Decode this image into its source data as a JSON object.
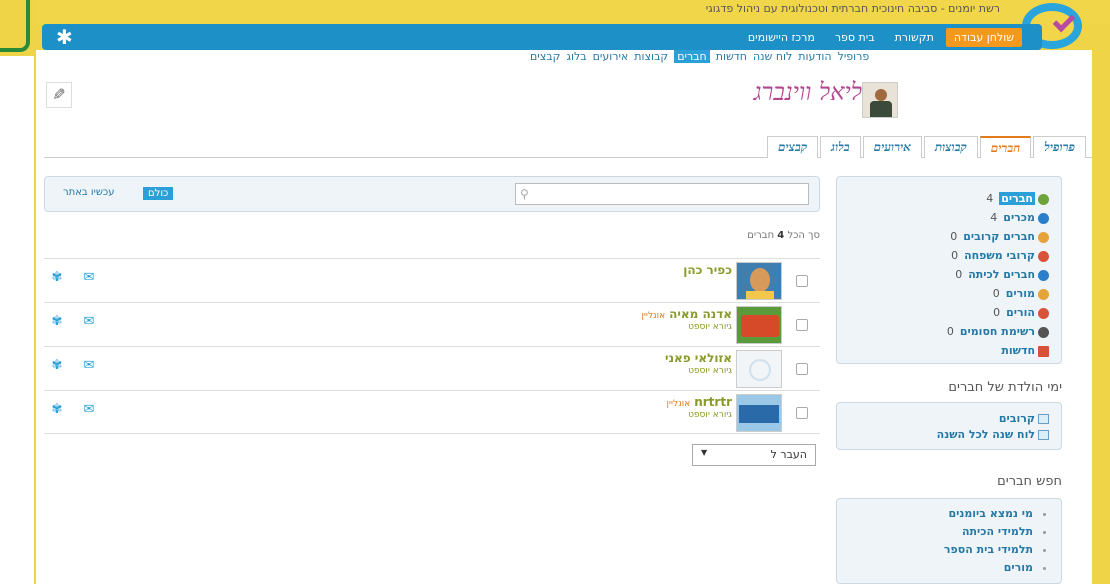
{
  "site": {
    "name": "רשת יומנים - סביבה חינוכית חברתית וטכנולוגית עם ניהול פדגוגי"
  },
  "nav": {
    "items": [
      {
        "label": "שולחן עבודה",
        "active": true
      },
      {
        "label": "תקשורת",
        "active": false
      },
      {
        "label": "בית ספר",
        "active": false
      },
      {
        "label": "מרכז היישומים",
        "active": false
      }
    ],
    "gear_icon": "gear-icon"
  },
  "subnav": {
    "items": [
      "פרופיל",
      "הודעות",
      "לוח שנה",
      "חדשות",
      "חברים",
      "קבוצות",
      "אירועים",
      "בלוג",
      "קבצים"
    ],
    "active_index": 4
  },
  "profile": {
    "name": "ליאל ווינברג"
  },
  "tabs": {
    "items": [
      "פרופיל",
      "חברים",
      "קבוצות",
      "אירועים",
      "בלוג",
      "קבצים"
    ],
    "active_index": 1
  },
  "side": {
    "items": [
      {
        "label": "חברים",
        "count": "4",
        "color": "#6ea33a",
        "active": true
      },
      {
        "label": "מכרים",
        "count": "4",
        "color": "#2a7fc8",
        "active": false
      },
      {
        "label": "חברים קרובים",
        "count": "0",
        "color": "#e6a33a",
        "active": false
      },
      {
        "label": "קרובי משפחה",
        "count": "0",
        "color": "#d8523a",
        "active": false
      },
      {
        "label": "חברים לכיתה",
        "count": "0",
        "color": "#2a7fc8",
        "active": false
      },
      {
        "label": "מורים",
        "count": "0",
        "color": "#e6a33a",
        "active": false
      },
      {
        "label": "הורים",
        "count": "0",
        "color": "#d8523a",
        "active": false
      },
      {
        "label": "רשימת חסומים",
        "count": "0",
        "color": "#555555",
        "active": false
      },
      {
        "label": "חדשות",
        "count": "",
        "color": "#d8523a",
        "active": false
      }
    ],
    "birthdays_title": "ימי הולדת של חברים",
    "birthdays": [
      "קרובים",
      "לוח שנה לכל השנה"
    ],
    "search_title": "חפש חברים",
    "search_items": [
      "מי נמצא ביומנים",
      "תלמידי הכיתה",
      "תלמידי בית הספר",
      "מורים"
    ]
  },
  "filter": {
    "search_placeholder": "",
    "all_label": "כולם",
    "online_label": "עכשיו באתר"
  },
  "total": {
    "prefix": "סך הכל",
    "count": "4",
    "suffix": "חברים"
  },
  "friends": [
    {
      "name": "כפיר כהן",
      "online": "",
      "school": ""
    },
    {
      "name": "אדנה מאיה",
      "online": "אונליין",
      "school": "גיורא יוספט"
    },
    {
      "name": "אזולאי פאני",
      "online": "",
      "school": "גיורא יוספט"
    },
    {
      "name": "nrtrtr",
      "online": "אונליין",
      "school": "גיורא יוספט"
    }
  ],
  "pager": {
    "selected": "העבר ל"
  }
}
